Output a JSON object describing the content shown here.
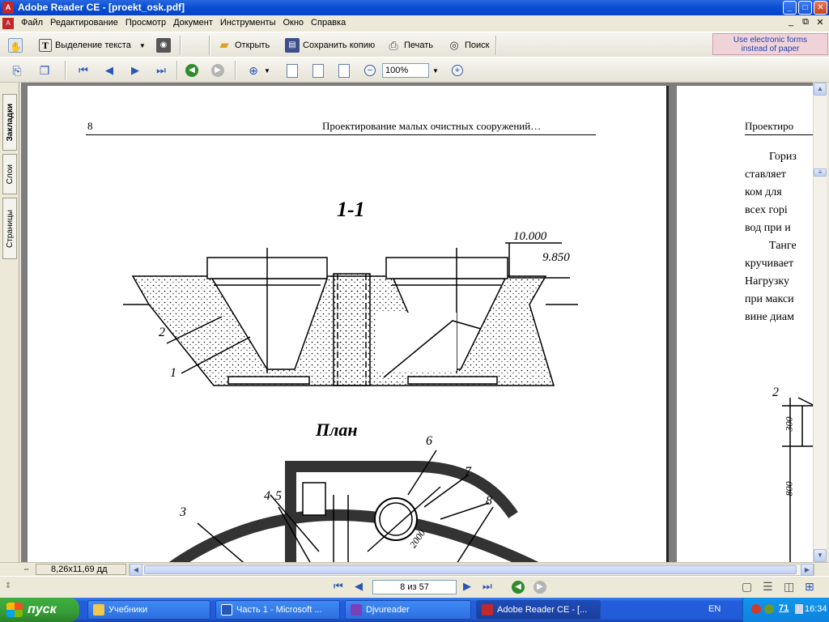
{
  "window": {
    "title": "Adobe Reader CE - [proekt_osk.pdf]",
    "min": "_",
    "max": "□",
    "close": "✕"
  },
  "menu": {
    "items": [
      "Файл",
      "Редактирование",
      "Просмотр",
      "Документ",
      "Инструменты",
      "Окно",
      "Справка"
    ],
    "mdi": [
      "_",
      "⧉",
      "✕"
    ]
  },
  "toolbar1": {
    "select_text": "Выделение текста",
    "open": "Открыть",
    "save_copy": "Сохранить копию",
    "print": "Печать",
    "search": "Поиск"
  },
  "eforms": {
    "line1": "Use electronic forms",
    "line2": "instead of paper"
  },
  "toolbar2": {
    "zoom": "100%"
  },
  "sidepanel": {
    "tabs": [
      "Закладки",
      "Слои",
      "Страницы"
    ]
  },
  "page_left": {
    "page_number": "8",
    "running_head": "Проектирование малых очистных сооружений…",
    "section_title": "1-1",
    "plan_title": "План",
    "elev_top": "10.000",
    "elev_mid": "9.850",
    "labels": [
      "1",
      "2",
      "3",
      "4",
      "5",
      "6",
      "7",
      "8"
    ],
    "dim_2000": "2000"
  },
  "page_right": {
    "running_head": "Проектиро",
    "lines": [
      "Гориз",
      "ставляет",
      "ком  для",
      "всех  горі",
      "вод при и",
      "Танге",
      "кручивает",
      "Нагрузку",
      "при макси",
      "вине диам"
    ],
    "label_2": "2",
    "dim_300": "300",
    "dim_800": "800"
  },
  "status": {
    "page_size": "8,26x11,69 дд",
    "page_of": "8 из 57"
  },
  "taskbar": {
    "start": "пуск",
    "tasks": [
      "Учебники",
      "Часть 1 - Microsoft ...",
      "Djvureader",
      "Adobe Reader CE - [..."
    ],
    "lang": "EN",
    "tray_num": "71",
    "clock": "16:34"
  }
}
